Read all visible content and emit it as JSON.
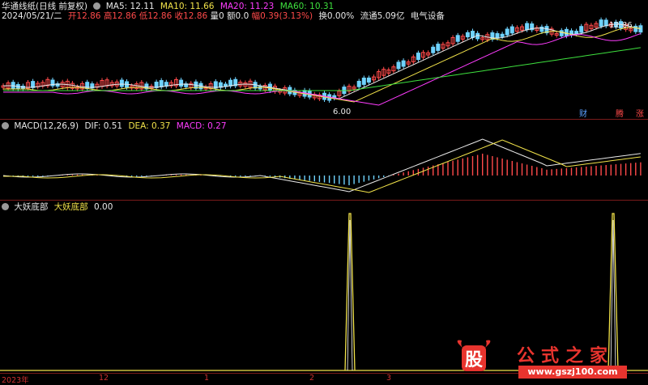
{
  "header": {
    "title": "华通线纸(日线 前复权)",
    "ma5": "MA5: 12.11",
    "ma10": "MA10: 11.66",
    "ma20": "MA20: 11.23",
    "ma60": "MA60: 10.31"
  },
  "quote": {
    "date": "2024/05/21/二",
    "open": "开12.86",
    "high": "高12.86",
    "low": "低12.86",
    "close": "收12.86",
    "volume": "量0",
    "amount": "额0.0",
    "change": "幅0.39(3.13%)",
    "turnover": "换0.00%",
    "float": "流通5.09亿",
    "sector": "电气设备"
  },
  "price_panel": {
    "high_label": "12.86",
    "low_label": "6.00",
    "badges": [
      "财",
      "腾",
      "涨"
    ]
  },
  "macd": {
    "title": "MACD(12,26,9)",
    "dif": "DIF: 0.51",
    "dea": "DEA: 0.37",
    "macd": "MACD: 0.27"
  },
  "indicator": {
    "name": "大妖底部",
    "series_label": "大妖底部",
    "value": "0.00"
  },
  "x_axis": {
    "labels": [
      "2023年",
      "12",
      "1",
      "2",
      "3"
    ]
  },
  "watermark": {
    "logo_char": "股",
    "text": "公式之家",
    "url": "www.gszj100.com"
  },
  "colors": {
    "ma5": "#e8e8e8",
    "ma10": "#f2e34a",
    "ma20": "#ff3cff",
    "ma60": "#3ee13e",
    "up": "#ff4a4a",
    "down": "#6fd3ff",
    "separator": "#7a1b1b"
  }
}
